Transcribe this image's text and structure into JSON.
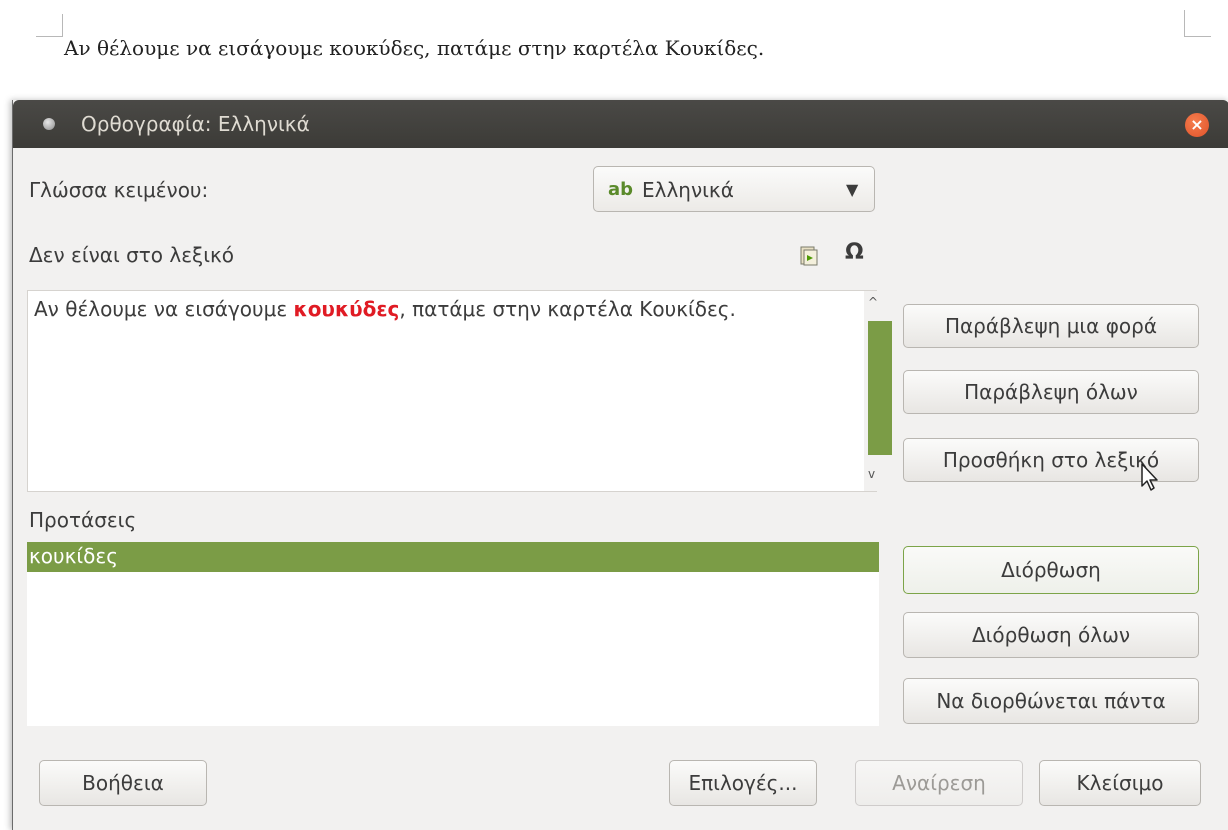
{
  "document": {
    "text": "Αν θέλουμε να εισάγουμε κουκύδες, πατάμε στην καρτέλα Κουκίδες."
  },
  "dialog": {
    "title": "Ορθογραφία: Ελληνικά",
    "text_language_label": "Γλώσσα κειμένου:",
    "language_select": {
      "value": "Ελληνικά",
      "icon": "spellcheck-ab-icon"
    },
    "not_in_dictionary_label": "Δεν είναι στο λεξικό",
    "sentence": {
      "before": "Αν θέλουμε να εισάγουμε ",
      "error_word": "κουκύδες",
      "after": ", πατάμε στην καρτέλα Κουκίδες."
    },
    "suggestions_label": "Προτάσεις",
    "suggestions": [
      "κουκίδες"
    ],
    "buttons": {
      "ignore_once": "Παράβλεψη μια φορά",
      "ignore_all": "Παράβλεψη όλων",
      "add_to_dictionary": "Προσθήκη στο λεξικό",
      "correct": "Διόρθωση",
      "correct_all": "Διόρθωση όλων",
      "always_correct": "Να διορθώνεται πάντα",
      "help": "Βοήθεια",
      "options": "Επιλογές...",
      "undo": "Αναίρεση",
      "close": "Κλείσιμο"
    },
    "colors": {
      "accent": "#7b9c46",
      "error": "#e01b24",
      "titlebar": "#3c3b37",
      "close": "#e0522a"
    }
  }
}
